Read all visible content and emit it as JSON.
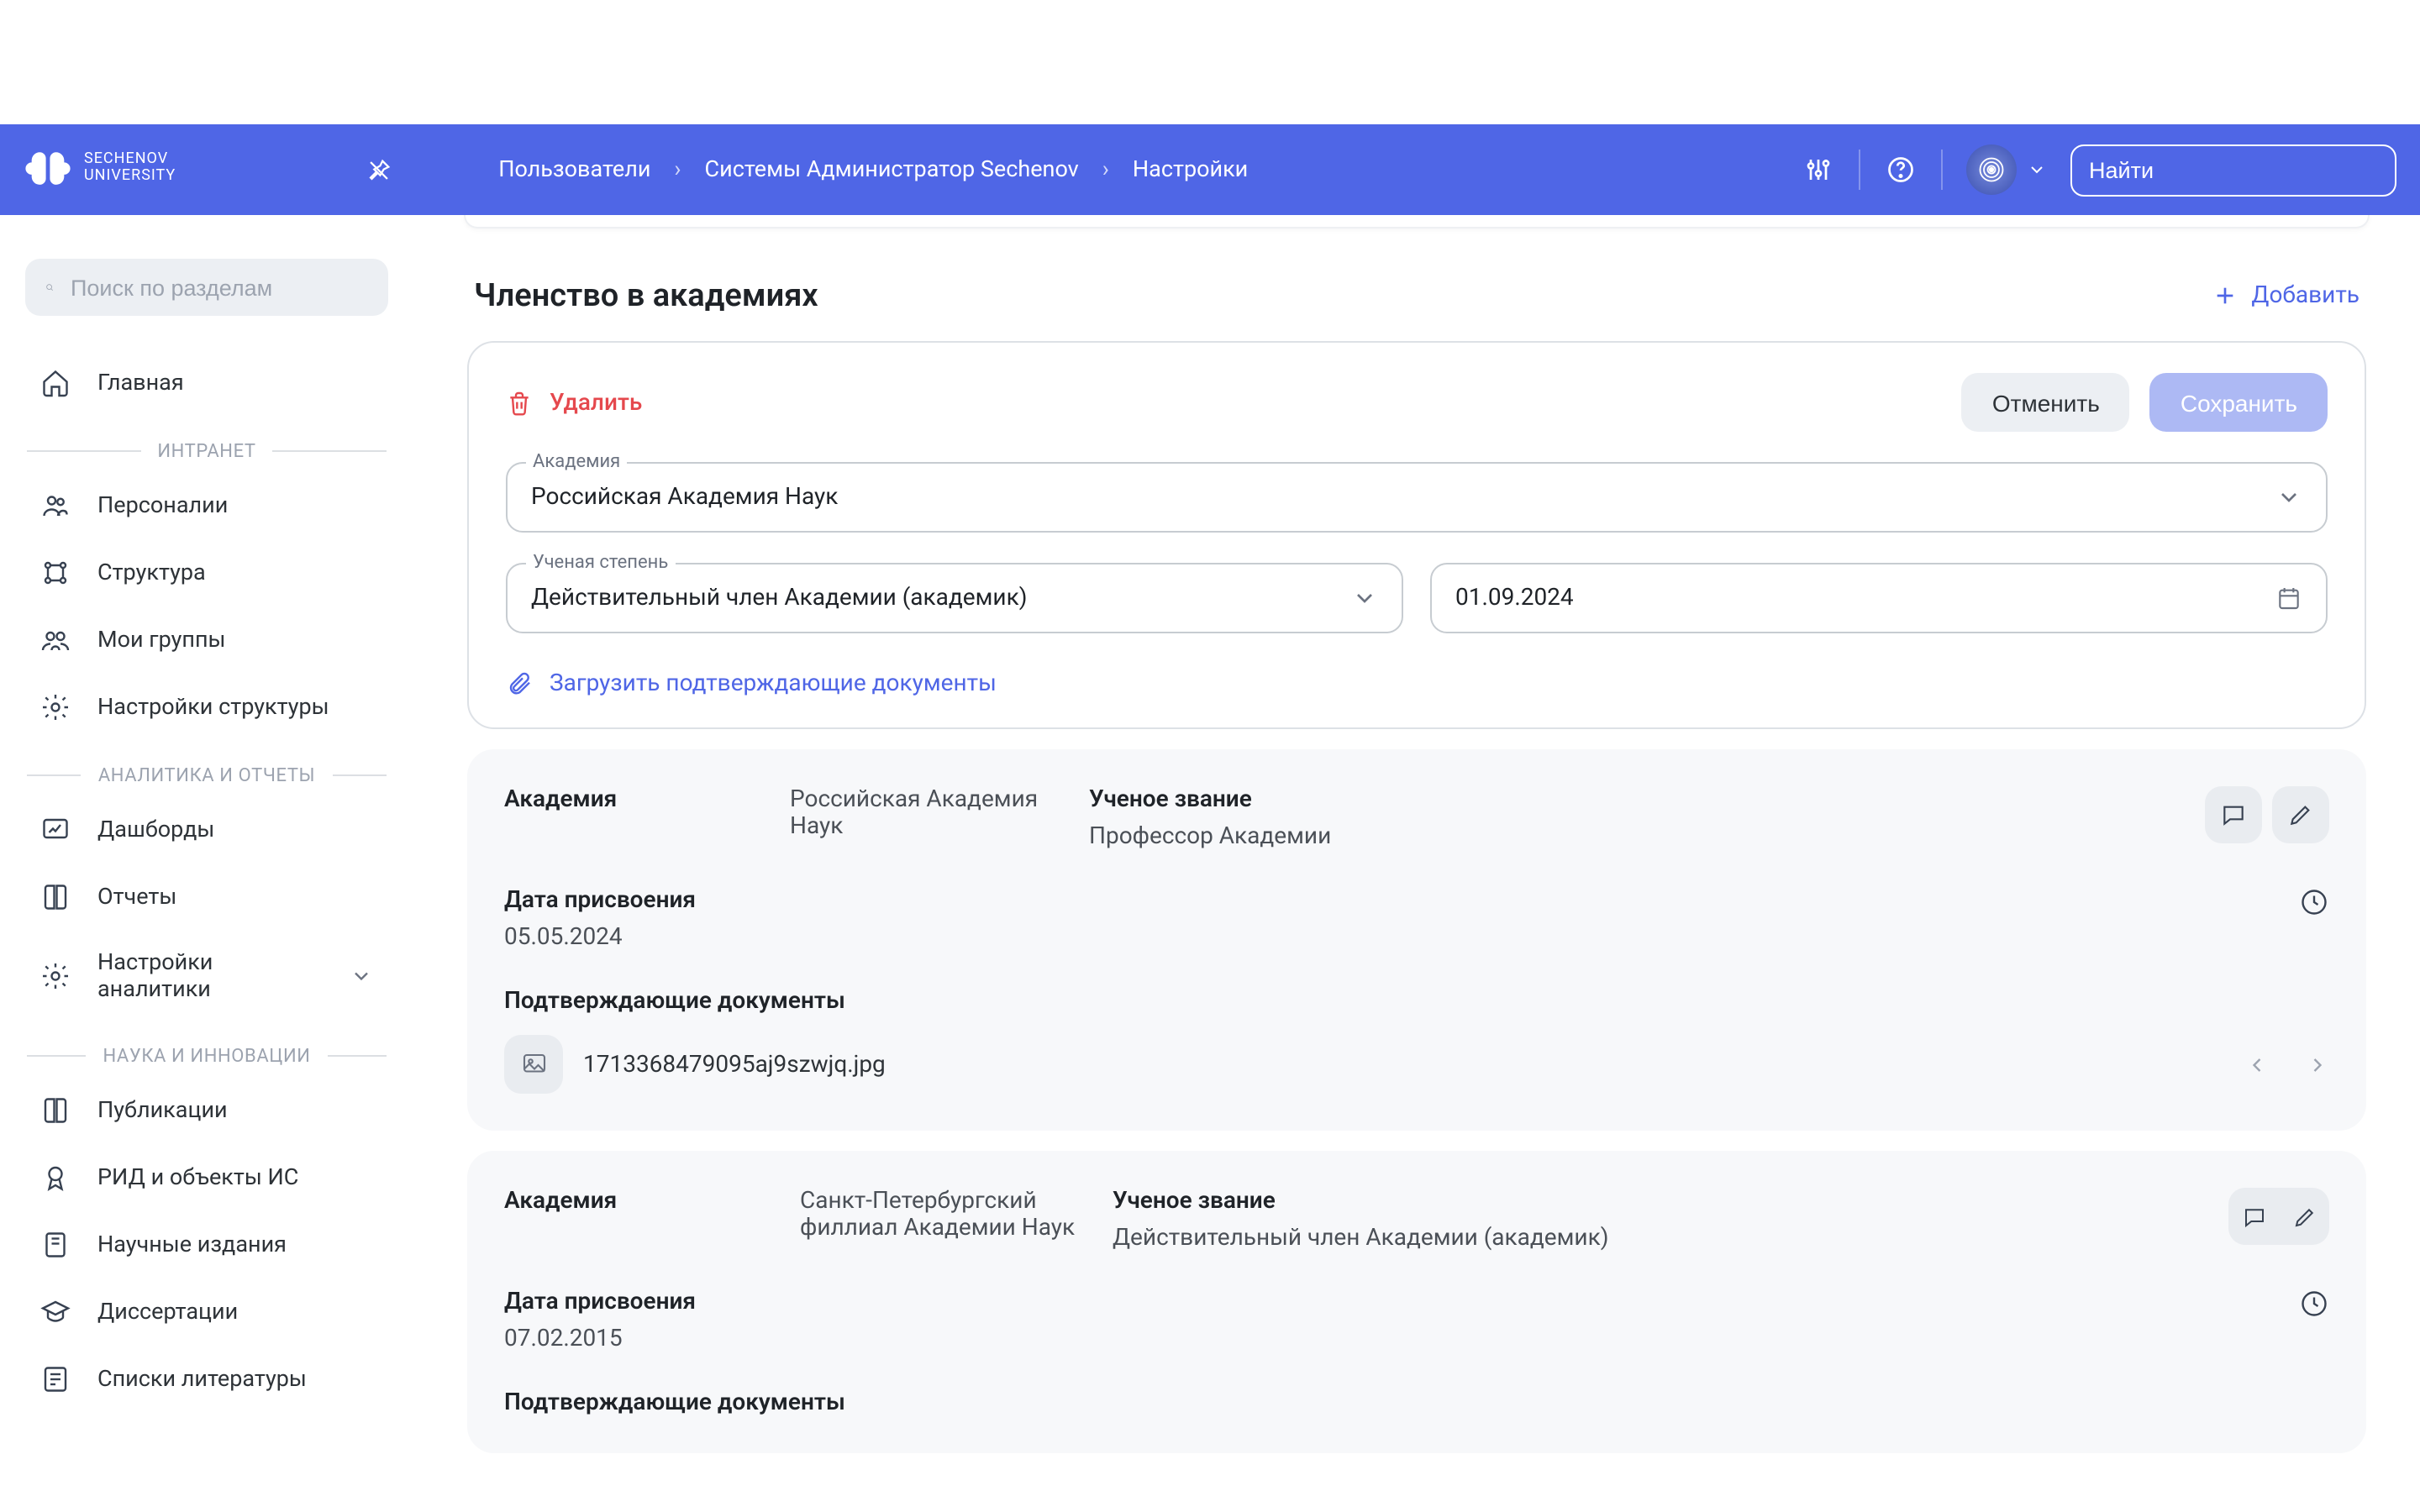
{
  "brand": "SECHENOV\nUNIVERSITY",
  "header": {
    "search_placeholder": "Найти",
    "breadcrumbs": [
      "Пользователи",
      "Системы Администратор Sechenov",
      "Настройки"
    ]
  },
  "sidebar": {
    "search_placeholder": "Поиск по разделам",
    "home": "Главная",
    "sections": [
      {
        "label": "ИНТРАНЕТ",
        "items": [
          "Персоналии",
          "Структура",
          "Мои группы",
          "Настройки структуры"
        ]
      },
      {
        "label": "АНАЛИТИКА И ОТЧЕТЫ",
        "items": [
          "Дашборды",
          "Отчеты",
          "Настройки аналитики"
        ]
      },
      {
        "label": "НАУКА И ИННОВАЦИИ",
        "items": [
          "Публикации",
          "РИД и объекты ИС",
          "Научные издания",
          "Диссертации",
          "Списки литературы"
        ]
      }
    ]
  },
  "main": {
    "section_title": "Членство в академиях",
    "add_label": "Добавить",
    "edit": {
      "delete_label": "Удалить",
      "cancel_label": "Отменить",
      "save_label": "Сохранить",
      "academy_label": "Академия",
      "academy_value": "Российская Академия Наук",
      "degree_label": "Ученая степень",
      "degree_value": "Действительный член Академии (академик)",
      "date_value": "01.09.2024",
      "upload_label": "Загрузить подтверждающие документы"
    },
    "records": [
      {
        "academy_label": "Академия",
        "academy_value": "Российская Академия Наук",
        "rank_label": "Ученое звание",
        "rank_value": "Профессор Академии",
        "date_label": "Дата присвоения",
        "date_value": "05.05.2024",
        "docs_label": "Подтверждающие документы",
        "doc_name": "1713368479095aj9szwjq.jpg"
      },
      {
        "academy_label": "Академия",
        "academy_value": "Санкт-Петербургский филлиал Академии Наук",
        "rank_label": "Ученое звание",
        "rank_value": "Действительный член Академии (академик)",
        "date_label": "Дата присвоения",
        "date_value": "07.02.2015",
        "docs_label": "Подтверждающие документы"
      }
    ]
  }
}
